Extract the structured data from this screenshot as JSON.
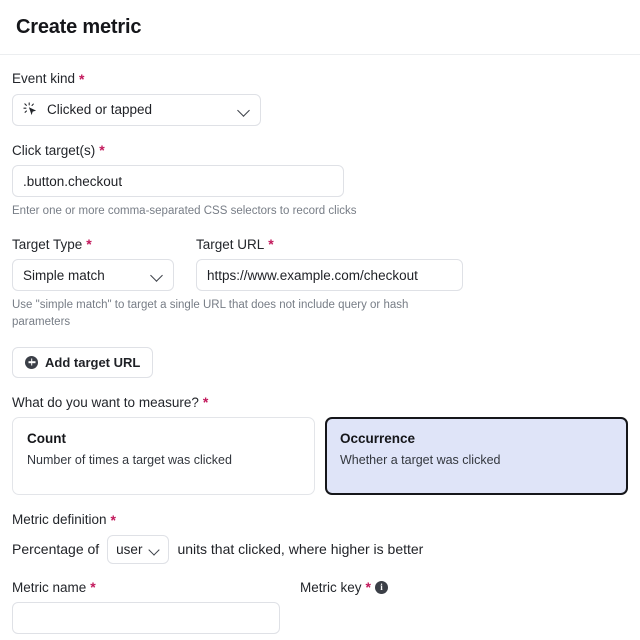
{
  "header": {
    "title": "Create metric"
  },
  "fields": {
    "event_kind": {
      "label": "Event kind",
      "required": "*",
      "value": "Clicked or tapped",
      "icon": "click-pointer-icon"
    },
    "click_targets": {
      "label": "Click target(s)",
      "required": "*",
      "value": ".button.checkout",
      "placeholder": "",
      "helper": "Enter one or more comma-separated CSS selectors to record clicks"
    },
    "target_type": {
      "label": "Target Type",
      "required": "*",
      "value": "Simple match"
    },
    "target_url": {
      "label": "Target URL",
      "required": "*",
      "value": "https://www.example.com/checkout",
      "placeholder": ""
    },
    "target_helper": "Use \"simple match\" to target a single URL that does not include query or hash parameters",
    "add_target_url": {
      "label": "Add target URL",
      "icon": "plus-circle-icon"
    },
    "measure": {
      "label": "What do you want to measure?",
      "required": "*",
      "options": [
        {
          "title": "Count",
          "desc": "Number of times a target was clicked",
          "selected": false
        },
        {
          "title": "Occurrence",
          "desc": "Whether a target was clicked",
          "selected": true
        }
      ]
    },
    "metric_definition": {
      "label": "Metric definition",
      "required": "*",
      "prefix": "Percentage of",
      "unit_value": "user",
      "suffix": "units that clicked, where higher is better"
    },
    "metric_name": {
      "label": "Metric name",
      "required": "*",
      "value": ""
    },
    "metric_key": {
      "label": "Metric key",
      "required": "*",
      "info_icon": "info-icon",
      "value": ""
    }
  },
  "colors": {
    "required_asterisk": "#c2185b",
    "selected_card_bg": "#dfe4f8",
    "selected_card_border": "#15161a",
    "border": "#dfe1e6",
    "helper_text": "#777d86"
  }
}
